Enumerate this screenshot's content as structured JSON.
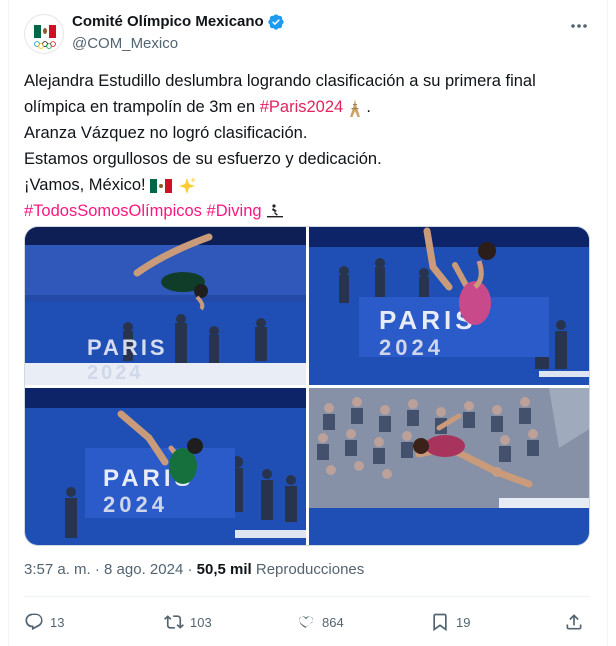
{
  "author": {
    "display_name": "Comité Olímpico Mexicano",
    "handle": "@COM_Mexico",
    "verified_icon": "verified-badge-icon",
    "avatar": "mexico-flag-olympic-rings"
  },
  "post": {
    "line1": "Alejandra Estudillo deslumbra logrando clasificación a su primera final",
    "line2_prefix": "olímpica en trampolín de 3m en ",
    "line2_hashtag": "#Paris2024",
    "line2_suffix": " .",
    "line3": "Aranza Vázquez no logró clasificación.",
    "line4": "Estamos orgullosos de su esfuerzo y dedicación.",
    "line5": "¡Vamos, México! ",
    "hashtag1": "#TodosSomosOlímpicos",
    "hashtag2": "#Diving",
    "emoji_tower": "eiffel-tower-emoji",
    "emoji_flag": "mexico-flag-emoji",
    "emoji_sparkles": "sparkles-emoji",
    "emoji_diving": "diving-pictogram"
  },
  "media": {
    "tiles": [
      {
        "label": "PARIS 2024",
        "caption": "diver-pike-position"
      },
      {
        "label": "PARIS 2024",
        "caption": "diver-pink-suit-backward"
      },
      {
        "label": "PARIS 2024",
        "caption": "diver-green-suit-twist"
      },
      {
        "label": "",
        "caption": "diver-pink-suit-layout"
      }
    ],
    "watermark_top": "PARIS",
    "watermark_bottom": "2024"
  },
  "meta": {
    "time": "3:57 a. m.",
    "separator": "·",
    "date": "8 ago. 2024",
    "views_count": "50,5 mil",
    "views_label": "Reproducciones"
  },
  "actions": {
    "replies": "13",
    "reposts": "103",
    "likes": "864",
    "bookmarks": "19"
  },
  "colors": {
    "hashtag": "#e0245e",
    "verified": "#1d9bf0",
    "muted": "#536471",
    "pool_blue": "#1f4fb4"
  }
}
